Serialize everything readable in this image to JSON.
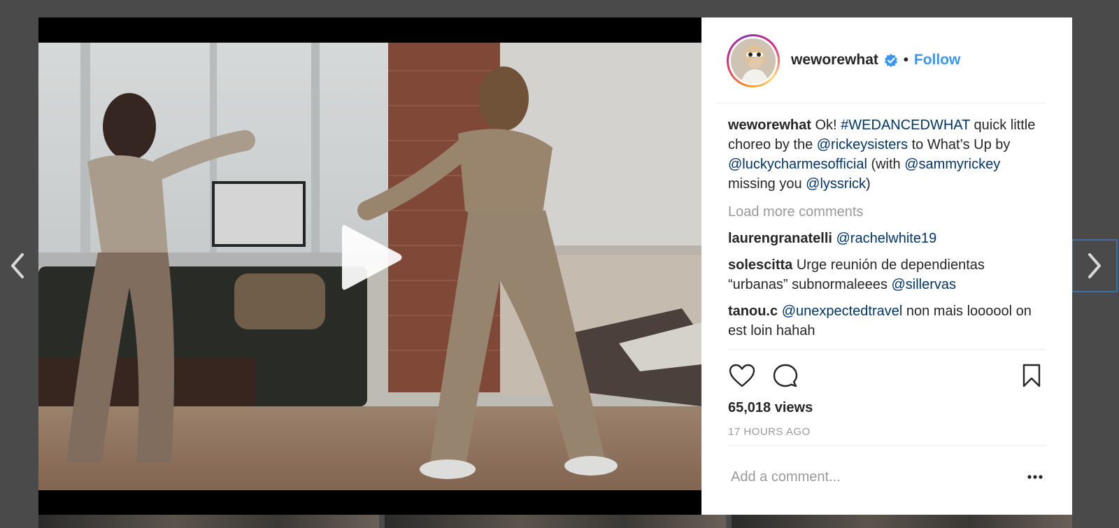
{
  "post": {
    "username": "weworewhat",
    "follow_label": "Follow",
    "separator": "•",
    "caption": {
      "user": "weworewhat",
      "parts": [
        {
          "t": "text",
          "v": " Ok! "
        },
        {
          "t": "tag",
          "v": "#WEDANCEDWHAT"
        },
        {
          "t": "text",
          "v": " quick little choreo by the "
        },
        {
          "t": "tag",
          "v": "@rickeysisters"
        },
        {
          "t": "text",
          "v": " to What’s Up by "
        },
        {
          "t": "tag",
          "v": "@luckycharmesofficial"
        },
        {
          "t": "text",
          "v": " (with "
        },
        {
          "t": "tag",
          "v": "@sammyrickey"
        },
        {
          "t": "text",
          "v": " missing you "
        },
        {
          "t": "tag",
          "v": "@lyssrick"
        },
        {
          "t": "text",
          "v": ")"
        }
      ]
    },
    "load_more": "Load more comments",
    "comments": [
      {
        "user": "laurengranatelli",
        "parts": [
          {
            "t": "text",
            "v": " "
          },
          {
            "t": "tag",
            "v": "@rachelwhite19"
          }
        ]
      },
      {
        "user": "solescitta",
        "parts": [
          {
            "t": "text",
            "v": " Urge reunión de dependientas “urbanas” subnormaleees "
          },
          {
            "t": "tag",
            "v": "@sillervas"
          }
        ]
      },
      {
        "user": "tanou.c",
        "parts": [
          {
            "t": "text",
            "v": " "
          },
          {
            "t": "tag",
            "v": "@unexpectedtravel"
          },
          {
            "t": "text",
            "v": " non mais loooool on est loin hahah"
          }
        ]
      }
    ],
    "views": "65,018 views",
    "time": "17 HOURS AGO",
    "comment_placeholder": "Add a comment...",
    "icons": {
      "like": "heart-icon",
      "comment": "comment-bubble-icon",
      "save": "bookmark-icon",
      "more": "more-dots-icon",
      "verified": "verified-badge-icon",
      "play": "play-icon",
      "prev": "chevron-left-icon",
      "next": "chevron-right-icon"
    },
    "colors": {
      "link": "#003569",
      "follow": "#3897f0",
      "verified": "#3897f0",
      "muted": "#999999",
      "backdrop": "#4a4a4a"
    }
  }
}
